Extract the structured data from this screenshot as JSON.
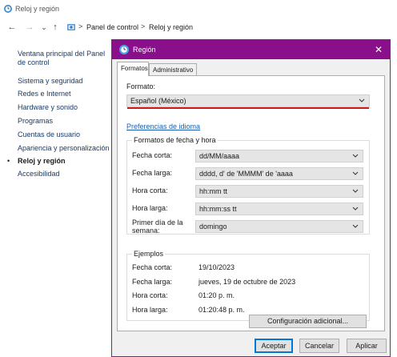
{
  "window": {
    "title": "Reloj y región"
  },
  "address_bar": {
    "crumbs": [
      "Panel de control",
      "Reloj y región"
    ],
    "separator": ">"
  },
  "sidebar": {
    "main_link": "Ventana principal del Panel de control",
    "items": [
      {
        "label": "Sistema y seguridad",
        "active": false
      },
      {
        "label": "Redes e Internet",
        "active": false
      },
      {
        "label": "Hardware y sonido",
        "active": false
      },
      {
        "label": "Programas",
        "active": false
      },
      {
        "label": "Cuentas de usuario",
        "active": false
      },
      {
        "label": "Apariencia y personalización",
        "active": false
      },
      {
        "label": "Reloj y región",
        "active": true
      },
      {
        "label": "Accesibilidad",
        "active": false
      }
    ],
    "active_bullet": "•"
  },
  "dialog": {
    "title": "Región",
    "close_glyph": "✕",
    "tabs": [
      {
        "label": "Formatos",
        "active": true
      },
      {
        "label": "Administrativo",
        "active": false
      }
    ],
    "format_label": "Formato:",
    "format_value": "Español (México)",
    "language_prefs_link": "Preferencias de idioma",
    "date_time_group": {
      "title": "Formatos de fecha y hora",
      "rows": [
        {
          "label": "Fecha corta:",
          "value": "dd/MM/aaaa"
        },
        {
          "label": "Fecha larga:",
          "value": "dddd, d' de 'MMMM' de 'aaaa"
        },
        {
          "label": "Hora corta:",
          "value": "hh:mm tt"
        },
        {
          "label": "Hora larga:",
          "value": "hh:mm:ss tt"
        },
        {
          "label": "Primer día de la semana:",
          "value": "domingo"
        }
      ]
    },
    "examples_group": {
      "title": "Ejemplos",
      "rows": [
        {
          "label": "Fecha corta:",
          "value": "19/10/2023"
        },
        {
          "label": "Fecha larga:",
          "value": "jueves, 19 de octubre de 2023"
        },
        {
          "label": "Hora corta:",
          "value": "01:20 p. m."
        },
        {
          "label": "Hora larga:",
          "value": "01:20:48 p. m."
        }
      ]
    },
    "additional_settings_button": "Configuración adicional...",
    "buttons": {
      "accept": "Aceptar",
      "cancel": "Cancelar",
      "apply": "Aplicar"
    }
  },
  "icons": {
    "window_icon": "clock-globe-icon",
    "back": "arrow-left-icon",
    "forward": "arrow-right-icon",
    "up": "arrow-up-icon",
    "combo": "chevron-down-icon",
    "close": "close-icon"
  },
  "colors": {
    "dialog_titlebar": "#8a0f8a",
    "link": "#1a5fb4",
    "focus_underline": "#cc1a1a",
    "default_button_border": "#0078d7"
  }
}
